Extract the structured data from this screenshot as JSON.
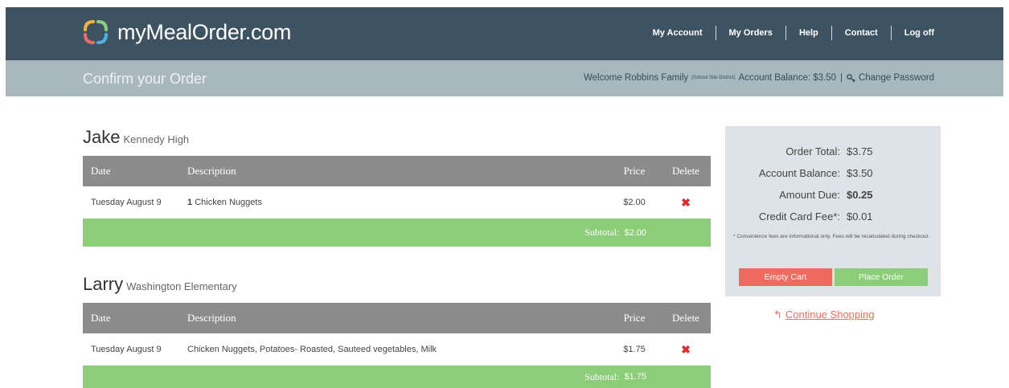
{
  "brand": {
    "name": "myMealOrder.com"
  },
  "nav": [
    {
      "label": "My Account"
    },
    {
      "label": "My Orders"
    },
    {
      "label": "Help"
    },
    {
      "label": "Contact"
    },
    {
      "label": "Log off"
    }
  ],
  "subheader": {
    "title": "Confirm your Order",
    "welcome": "Welcome Robbins Family",
    "district": "(School Site District)",
    "balance": "Account Balance: $3.50",
    "separator": "|",
    "change_password": "Change Password"
  },
  "table_headers": {
    "date": "Date",
    "description": "Description",
    "price": "Price",
    "delete": "Delete"
  },
  "students": [
    {
      "name": "Jake",
      "school": "Kennedy High",
      "rows": [
        {
          "date": "Tuesday August 9",
          "qty": "1",
          "description": "Chicken Nuggets",
          "price": "$2.00",
          "delete_glyph": "✖"
        }
      ],
      "subtotal_label": "Subtotal:",
      "subtotal": "$2.00"
    },
    {
      "name": "Larry",
      "school": "Washington Elementary",
      "rows": [
        {
          "date": "Tuesday August 9",
          "qty": "",
          "description": "Chicken Nuggets, Potatoes- Roasted, Sauteed vegetables, Milk",
          "price": "$1.75",
          "delete_glyph": "✖"
        }
      ],
      "subtotal_label": "Subtotal:",
      "subtotal": "$1.75"
    }
  ],
  "summary": {
    "order_total_label": "Order Total:",
    "order_total": "$3.75",
    "account_balance_label": "Account Balance:",
    "account_balance": "$3.50",
    "amount_due_label": "Amount Due:",
    "amount_due": "$0.25",
    "cc_fee_label": "Credit Card Fee*:",
    "cc_fee": "$0.01",
    "note": "* Convenience fees are informational only. Fees will be recalculated during checkout.",
    "empty_cart": "Empty Cart",
    "place_order": "Place Order"
  },
  "continue_shopping": {
    "arrow": "↰",
    "label": "Continue Shopping"
  },
  "colors": {
    "topbar": "#3e5361",
    "subbar": "#a9b7bf",
    "table_header": "#8c8c8c",
    "subtotal_bar": "#8ccd78",
    "delete": "#e22b2b",
    "empty_cart": "#ef6b60",
    "summary_bg": "#dde3e6",
    "link": "#ee6e5a"
  }
}
